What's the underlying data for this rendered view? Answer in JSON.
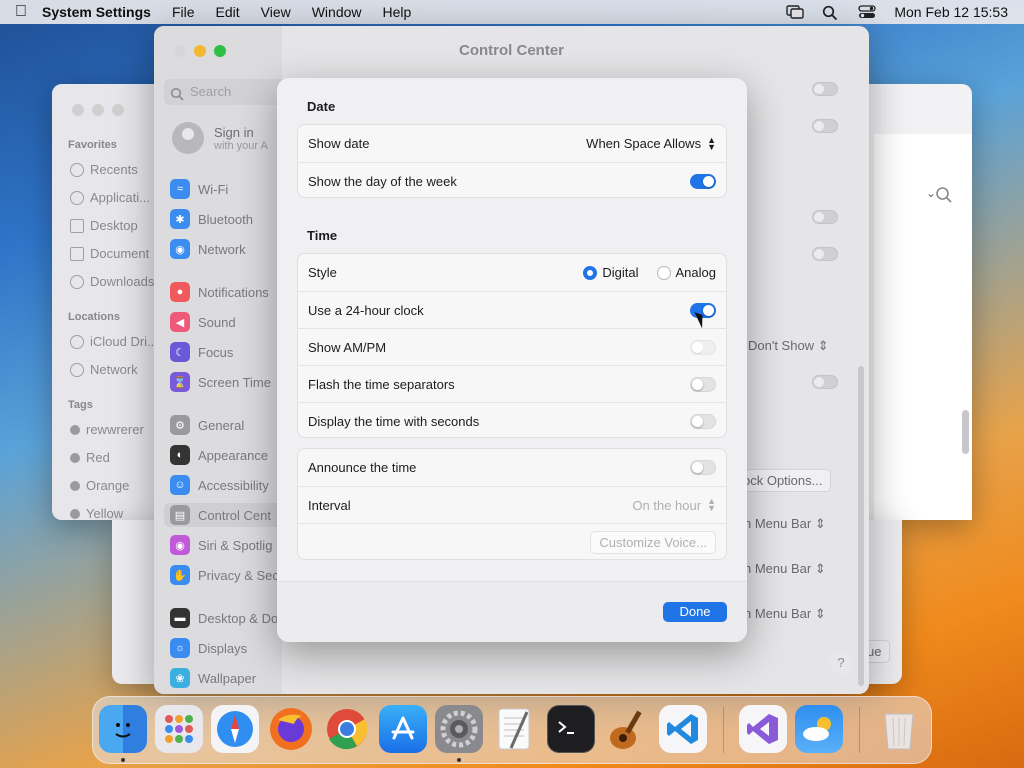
{
  "menubar": {
    "app": "System Settings",
    "items": [
      "File",
      "Edit",
      "View",
      "Window",
      "Help"
    ],
    "clock": "Mon Feb 12  15:53"
  },
  "finder": {
    "favorites_header": "Favorites",
    "favorites": [
      "Recents",
      "Applicati...",
      "Desktop",
      "Document",
      "Downloads"
    ],
    "locations_header": "Locations",
    "locations": [
      "iCloud Dri...",
      "Network"
    ],
    "tags_header": "Tags",
    "tags": [
      "rewwrerer",
      "Red",
      "Orange",
      "Yellow"
    ]
  },
  "settings": {
    "title": "Control Center",
    "search_placeholder": "Search",
    "signin_title": "Sign in",
    "signin_subtitle": "with your A",
    "sidebar": [
      "Wi-Fi",
      "Bluetooth",
      "Network",
      "Notifications",
      "Sound",
      "Focus",
      "Screen Time",
      "General",
      "Appearance",
      "Accessibility",
      "Control Cent",
      "Siri & Spotlig",
      "Privacy & Sec",
      "Desktop & Do",
      "Displays",
      "Wallpaper"
    ],
    "right_texts": {
      "dont_show": "Don't Show",
      "clock_options": "ock Options...",
      "menu_bar_1": "n Menu Bar",
      "menu_bar_2": "n Menu Bar",
      "menu_bar_3": "n Menu Bar",
      "continue_fragment": "ue",
      "help": "?"
    }
  },
  "modal": {
    "date_header": "Date",
    "show_date_label": "Show date",
    "show_date_value": "When Space Allows",
    "show_day_label": "Show the day of the week",
    "show_day_on": true,
    "time_header": "Time",
    "style_label": "Style",
    "style_digital": "Digital",
    "style_analog": "Analog",
    "style_selected": "Digital",
    "clock24_label": "Use a 24-hour clock",
    "clock24_on": true,
    "ampm_label": "Show AM/PM",
    "ampm_on": false,
    "flash_label": "Flash the time separators",
    "flash_on": false,
    "seconds_label": "Display the time with seconds",
    "seconds_on": false,
    "announce_label": "Announce the time",
    "announce_on": false,
    "interval_label": "Interval",
    "interval_value": "On the hour",
    "customize_voice": "Customize Voice...",
    "done": "Done"
  },
  "colors": {
    "accent": "#1f74e8"
  },
  "dock": [
    "Finder",
    "Launchpad",
    "Safari",
    "Firefox",
    "Chrome",
    "App Store",
    "System Settings",
    "TextEdit",
    "Terminal",
    "GarageBand",
    "VS Code",
    "Visual Studio",
    "Weather",
    "Trash"
  ]
}
